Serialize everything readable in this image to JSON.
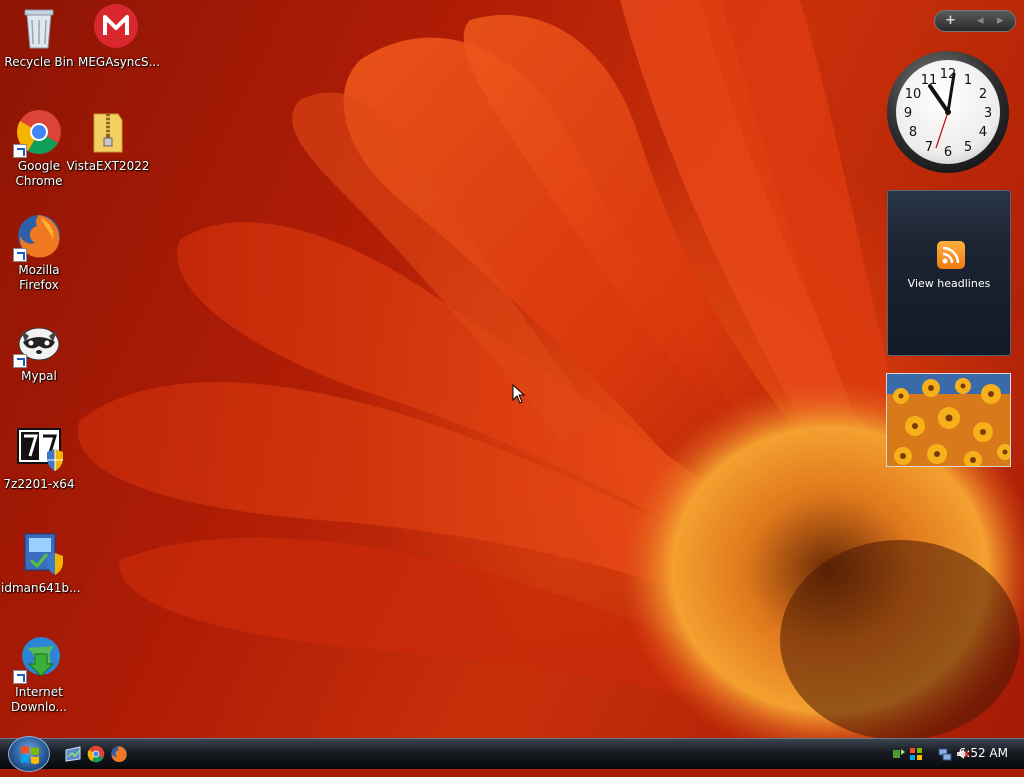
{
  "desktop": {
    "icons": [
      {
        "label": "Recycle Bin"
      },
      {
        "label": "MEGAsyncS..."
      },
      {
        "label": "Google\nChrome"
      },
      {
        "label": "VistaEXT2022"
      },
      {
        "label": "Mozilla\nFirefox"
      },
      {
        "label": "Mypal"
      },
      {
        "label": "7z2201-x64"
      },
      {
        "label": "idman641b..."
      },
      {
        "label": "Internet\nDownlo..."
      }
    ]
  },
  "sidebar": {
    "add_gadget": "+",
    "prev": "◂",
    "next": "▸",
    "clock_numbers": [
      "12",
      "1",
      "2",
      "3",
      "4",
      "5",
      "6",
      "7",
      "8",
      "9",
      "10",
      "11"
    ],
    "feed_label": "View headlines"
  },
  "taskbar": {
    "time": "6:52 AM"
  },
  "colors": {
    "accent": "#c8300a",
    "taskbar": "#171b22"
  }
}
